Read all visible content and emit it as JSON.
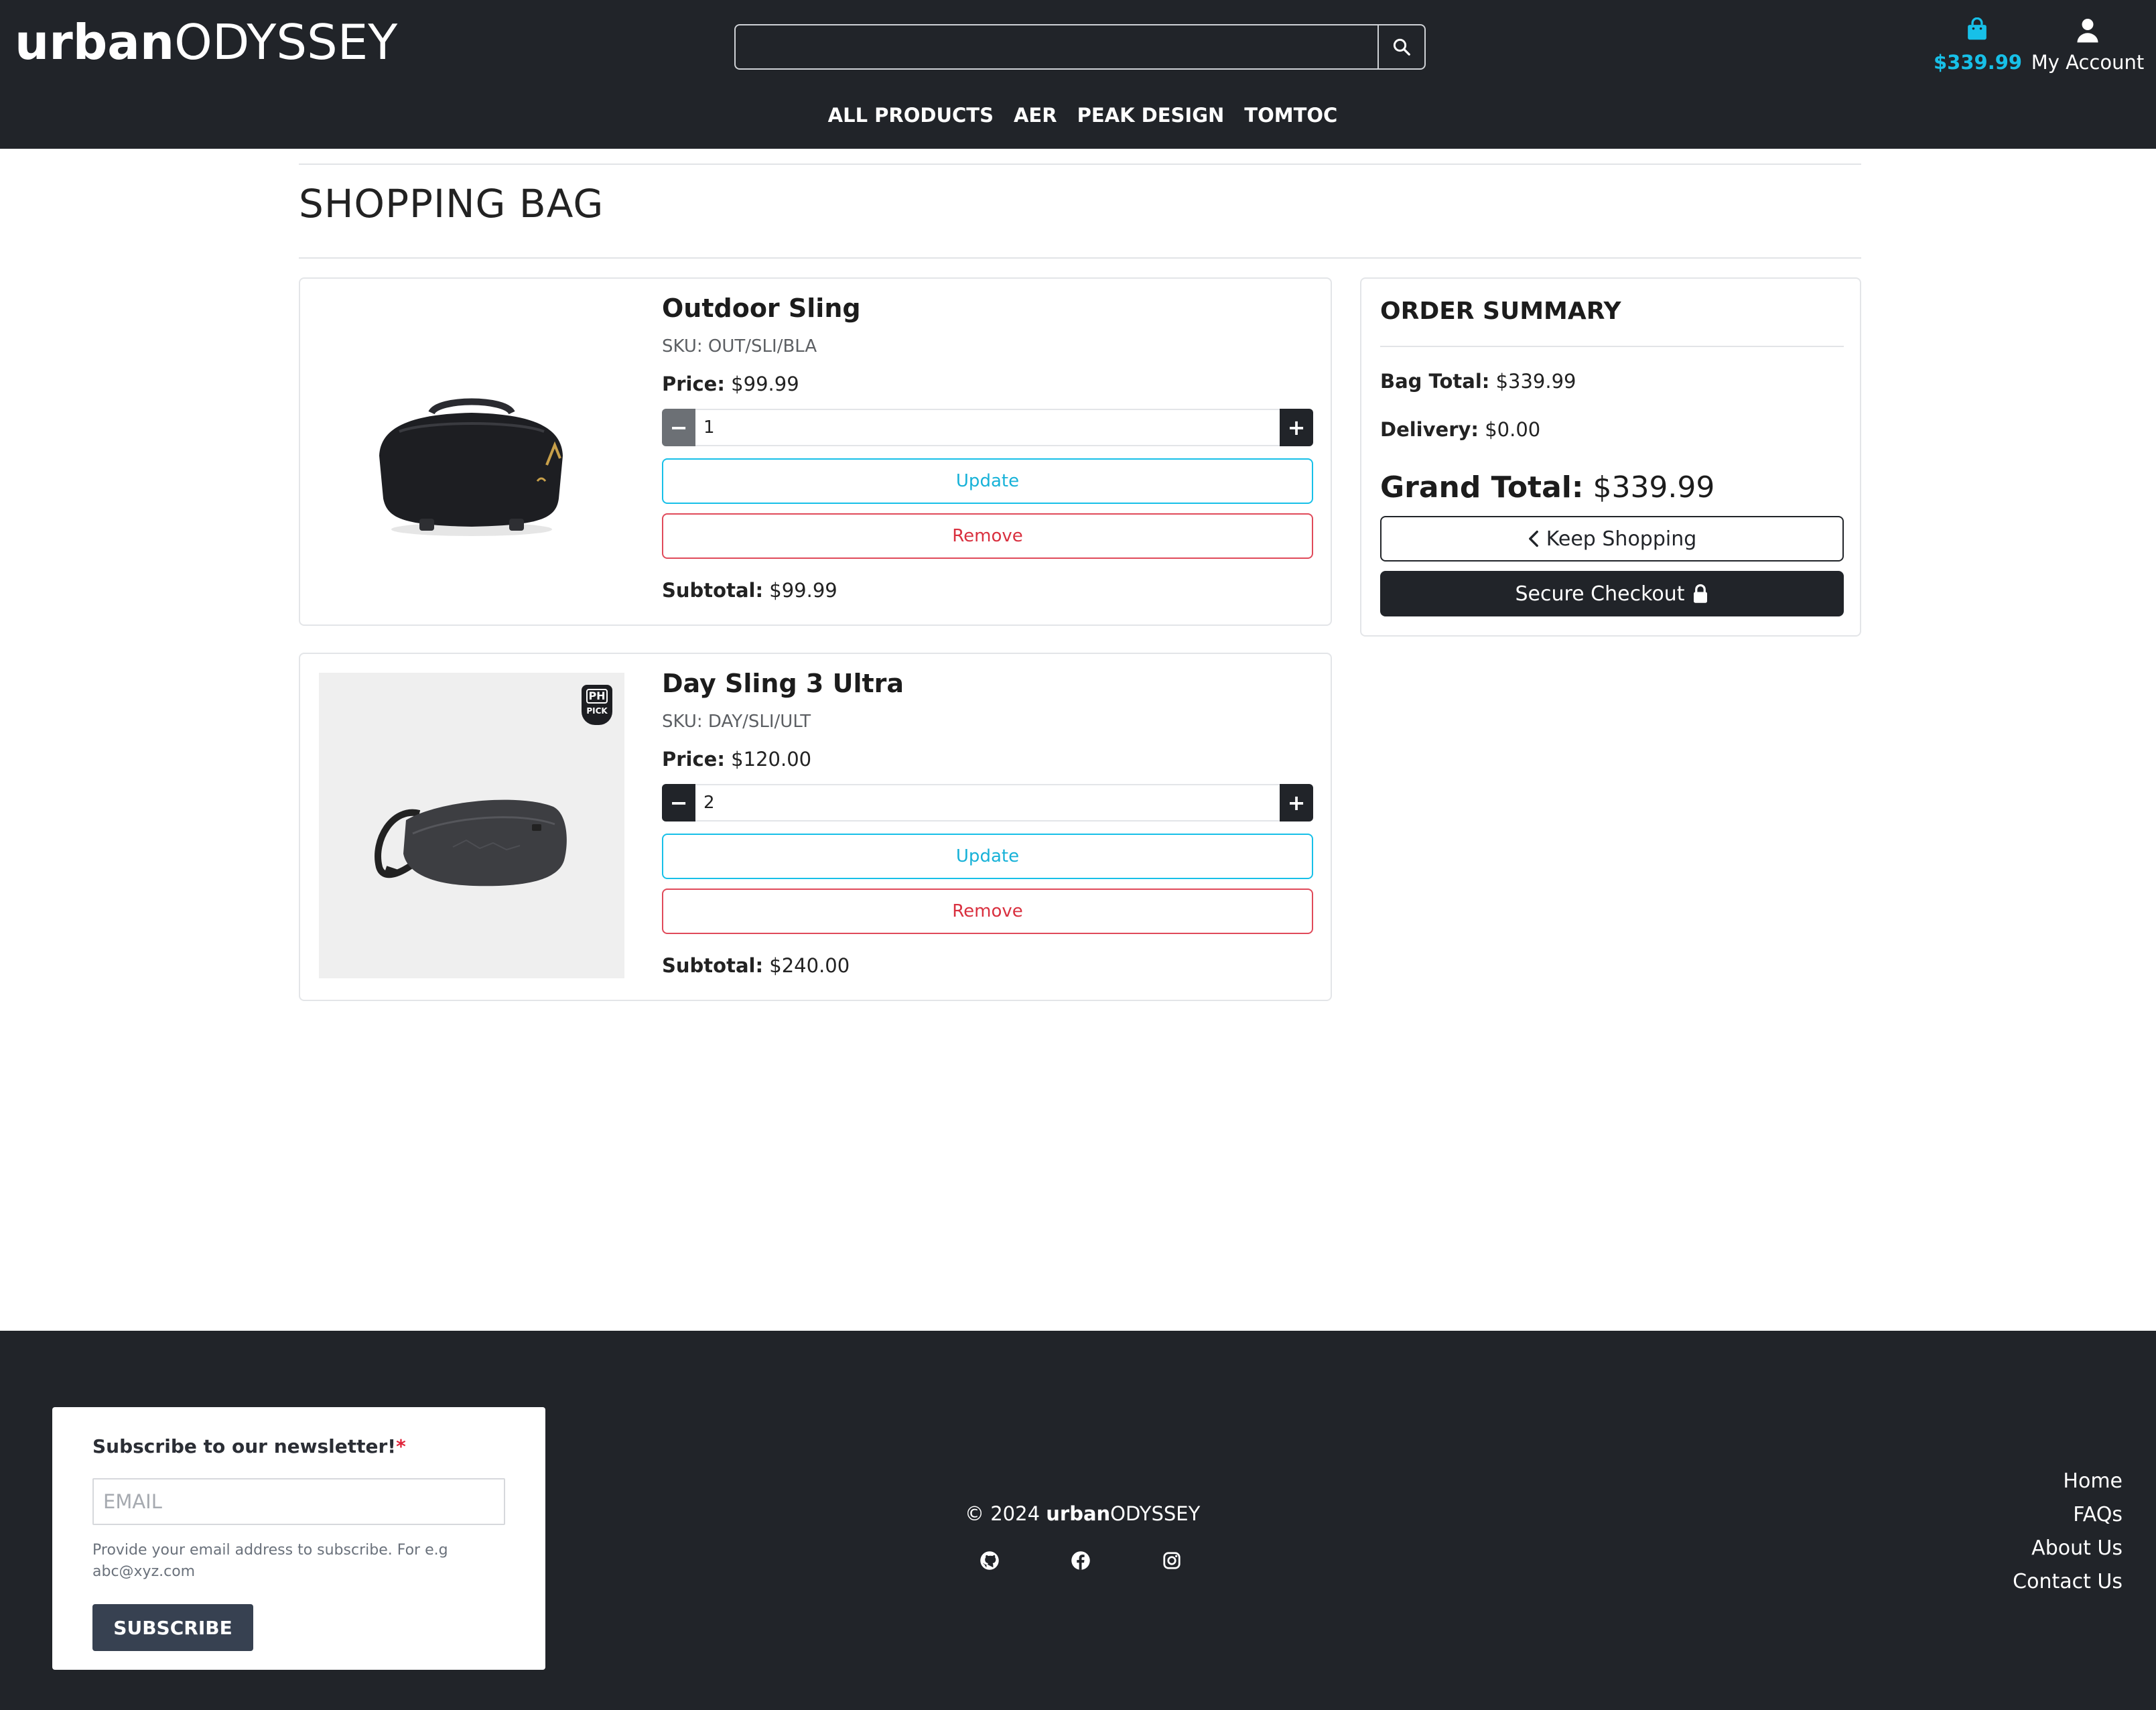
{
  "header": {
    "logo_bold": "urban",
    "logo_light": "ODYSSEY",
    "search": {
      "placeholder": "",
      "value": ""
    },
    "bag_total": "$339.99",
    "account_label": "My Account",
    "nav": [
      "ALL PRODUCTS",
      "AER",
      "PEAK DESIGN",
      "TOMTOC"
    ]
  },
  "page": {
    "title": "SHOPPING BAG"
  },
  "items": [
    {
      "name": "Outdoor Sling",
      "sku": "SKU: OUT/SLI/BLA",
      "price_label": "Price:",
      "price": "$99.99",
      "quantity": "1",
      "update_label": "Update",
      "remove_label": "Remove",
      "subtotal_label": "Subtotal:",
      "subtotal": "$99.99"
    },
    {
      "name": "Day Sling 3 Ultra",
      "sku": "SKU: DAY/SLI/ULT",
      "price_label": "Price:",
      "price": "$120.00",
      "quantity": "2",
      "update_label": "Update",
      "remove_label": "Remove",
      "subtotal_label": "Subtotal:",
      "subtotal": "$240.00",
      "badge_line1": "PH",
      "badge_line2": "PICK"
    }
  ],
  "summary": {
    "title": "ORDER SUMMARY",
    "bag_total_label": "Bag Total:",
    "bag_total": "$339.99",
    "delivery_label": "Delivery:",
    "delivery": "$0.00",
    "grand_total_label": "Grand Total:",
    "grand_total": "$339.99",
    "keep_shopping_label": "Keep Shopping",
    "checkout_label": "Secure Checkout"
  },
  "footer": {
    "newsletter": {
      "title": "Subscribe to our newsletter!",
      "required_mark": "*",
      "email_placeholder": "EMAIL",
      "help_text": "Provide your email address to subscribe. For e.g abc@xyz.com",
      "button_label": "SUBSCRIBE"
    },
    "copyright_prefix": "© 2024 ",
    "copyright_bold": "urban",
    "copyright_light": "ODYSSEY",
    "social": [
      "github-icon",
      "facebook-icon",
      "instagram-icon"
    ],
    "links": [
      "Home",
      "FAQs",
      "About Us",
      "Contact Us"
    ]
  },
  "colors": {
    "header_bg": "#212429",
    "accent": "#17c0e8",
    "danger": "#d9303f",
    "button_dark": "#212429",
    "subscribe_button": "#374151"
  }
}
